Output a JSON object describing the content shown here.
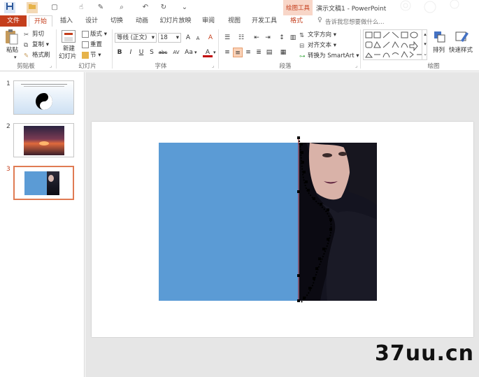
{
  "window": {
    "title": "演示文稿1 - PowerPoint",
    "context_tab_group": "绘图工具"
  },
  "quick_access": {
    "icons": [
      "save-icon",
      "open-icon",
      "print-preview-icon",
      "touch-mode-icon",
      "format-painter-icon",
      "preview-icon",
      "undo-icon",
      "redo-icon",
      "customize-icon"
    ]
  },
  "tabs": [
    {
      "label": "文件"
    },
    {
      "label": "开始"
    },
    {
      "label": "插入"
    },
    {
      "label": "设计"
    },
    {
      "label": "切换"
    },
    {
      "label": "动画"
    },
    {
      "label": "幻灯片放映"
    },
    {
      "label": "审阅"
    },
    {
      "label": "视图"
    },
    {
      "label": "开发工具"
    },
    {
      "label": "格式"
    }
  ],
  "tell_me": {
    "placeholder": "告诉我您想要做什么..."
  },
  "ribbon": {
    "clipboard": {
      "label": "剪贴板",
      "paste": "粘贴",
      "cut": "剪切",
      "copy": "复制",
      "format_painter": "格式刷"
    },
    "slides": {
      "label": "幻灯片",
      "new_slide_1": "新建",
      "new_slide_2": "幻灯片",
      "layout": "版式",
      "reset": "重置",
      "section": "节"
    },
    "font": {
      "label": "字体",
      "font_name": "等线 (正文)",
      "font_size": "18",
      "bold": "B",
      "italic": "I",
      "underline": "U",
      "shadow": "S",
      "strikethrough": "abc",
      "spacing": "AV",
      "case": "Aa",
      "color": "A",
      "grow": "A",
      "shrink": "A"
    },
    "paragraph": {
      "label": "段落",
      "text_direction": "文字方向",
      "align_text": "对齐文本",
      "smartart": "转换为 SmartArt"
    },
    "drawing": {
      "label": "绘图",
      "arrange": "排列",
      "quick_styles": "快速样式"
    }
  },
  "slides_pane": {
    "slides": [
      {
        "number": "1"
      },
      {
        "number": "2"
      },
      {
        "number": "3"
      }
    ],
    "selected": "3"
  },
  "colors": {
    "accent": "#c43e1c",
    "slide_blue": "#5b9bd5",
    "selection_border": "#e07b53"
  },
  "watermark": "37uu.cn"
}
